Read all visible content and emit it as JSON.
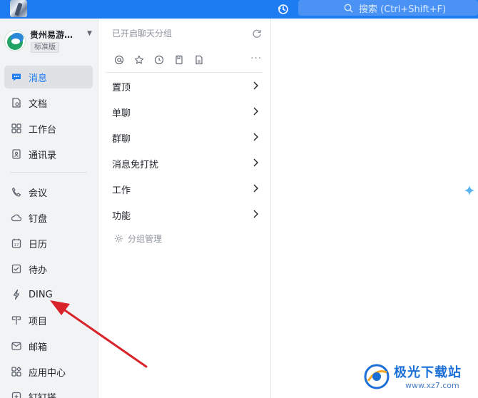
{
  "colors": {
    "topbar": "#1d7cf2",
    "search_bg": "#4a93f5",
    "sidebar_bg": "#f2f3f5",
    "arrow": "#d9232a",
    "watermark": "#1b6fd6"
  },
  "topbar": {
    "search_placeholder": "搜索 (Ctrl+Shift+F)",
    "history_icon": "history-clock-icon",
    "search_icon": "search-icon"
  },
  "org": {
    "name": "贵州易游…",
    "badge": "标准版"
  },
  "sidebar": {
    "items": [
      {
        "label": "消息",
        "icon": "message-icon",
        "active": true
      },
      {
        "label": "文档",
        "icon": "document-icon",
        "active": false
      },
      {
        "label": "工作台",
        "icon": "workbench-icon",
        "active": false
      },
      {
        "label": "通讯录",
        "icon": "contacts-icon",
        "active": false
      },
      {
        "label": "会议",
        "icon": "meeting-icon",
        "active": false
      },
      {
        "label": "钉盘",
        "icon": "cloud-disk-icon",
        "active": false
      },
      {
        "label": "日历",
        "icon": "calendar-icon",
        "active": false
      },
      {
        "label": "待办",
        "icon": "todo-icon",
        "active": false
      },
      {
        "label": "DING",
        "icon": "lightning-icon",
        "active": false
      },
      {
        "label": "项目",
        "icon": "project-icon",
        "active": false
      },
      {
        "label": "邮箱",
        "icon": "mail-icon",
        "active": false
      },
      {
        "label": "应用中心",
        "icon": "app-center-icon",
        "active": false
      },
      {
        "label": "钉钉搭",
        "icon": "builder-icon",
        "active": false
      }
    ]
  },
  "panel": {
    "header": "已开启聊天分组",
    "filters": [
      "at-icon",
      "star-icon",
      "clock-icon",
      "bookmark-icon",
      "file-icon"
    ],
    "groups": [
      {
        "label": "置顶"
      },
      {
        "label": "单聊"
      },
      {
        "label": "群聊"
      },
      {
        "label": "消息免打扰"
      },
      {
        "label": "工作"
      },
      {
        "label": "功能"
      }
    ],
    "manage": "分组管理"
  },
  "watermark": {
    "title": "极光下载站",
    "url": "www.xz7.com"
  }
}
